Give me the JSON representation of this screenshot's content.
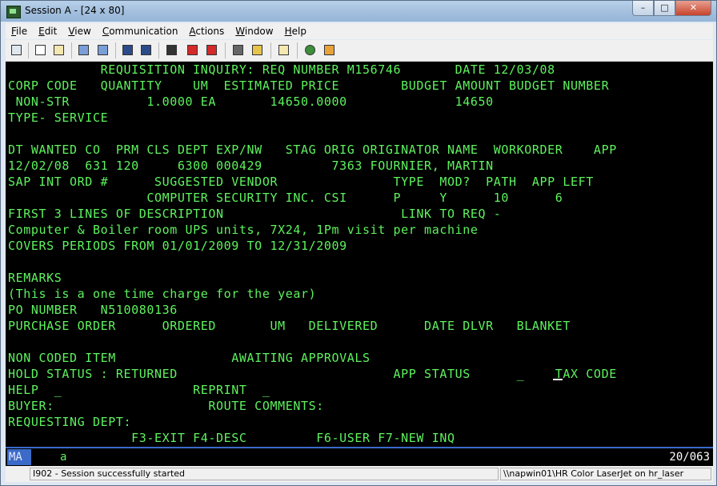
{
  "window": {
    "title": "Session A - [24 x 80]",
    "controls": {
      "minimize": "–",
      "maximize": "□",
      "close": "✕"
    }
  },
  "menu": [
    "File",
    "Edit",
    "View",
    "Communication",
    "Actions",
    "Window",
    "Help"
  ],
  "menu_mnemonics": [
    "F",
    "E",
    "V",
    "C",
    "A",
    "W",
    "H"
  ],
  "toolbar": [
    "print-screen",
    "copy",
    "paste",
    "send-file",
    "receive-file",
    "display-setup",
    "record-macro",
    "play-macro",
    "stop-macro",
    "macro-options",
    "clipboard",
    "map",
    "help"
  ],
  "screen": {
    "lines": [
      "            REQUISITION INQUIRY: REQ NUMBER M156746       DATE 12/03/08",
      "CORP CODE   QUANTITY    UM  ESTIMATED PRICE        BUDGET AMOUNT BUDGET NUMBER",
      " NON-STR          1.0000 EA       14650.0000              14650",
      "TYPE- SERVICE",
      "",
      "DT WANTED CO  PRM CLS DEPT EXP/NW   STAG ORIG ORIGINATOR NAME  WORKORDER    APP",
      "12/02/08  631 120     6300 000429         7363 FOURNIER, MARTIN",
      "SAP INT ORD #      SUGGESTED VENDOR               TYPE  MOD?  PATH  APP LEFT",
      "                  COMPUTER SECURITY INC. CSI      P     Y      10      6",
      "FIRST 3 LINES OF DESCRIPTION                       LINK TO REQ -",
      "Computer & Boiler room UPS units, 7X24, 1Pm visit per machine",
      "COVERS PERIODS FROM 01/01/2009 TO 12/31/2009",
      "",
      "REMARKS",
      "(This is a one time charge for the year)",
      "PO NUMBER   N510080136",
      "PURCHASE ORDER      ORDERED       UM   DELIVERED      DATE DLVR   BLANKET",
      "",
      "NON CODED ITEM               AWAITING APPROVALS",
      "HOLD STATUS : RETURNED                            APP STATUS      _    TAX CODE",
      "HELP  _                 REPRINT  _",
      "BUYER:                    ROUTE COMMENTS:",
      "REQUESTING DEPT:",
      "                F3-EXIT F4-DESC         F6-USER F7-NEW INQ"
    ]
  },
  "oia": {
    "mode": "MA",
    "indicator": "a",
    "cursor_position": "20/063"
  },
  "statusbar": {
    "message": "I902 - Session successfully started",
    "printer": "\\\\napwin01\\HR Color LaserJet on hr_laser"
  }
}
